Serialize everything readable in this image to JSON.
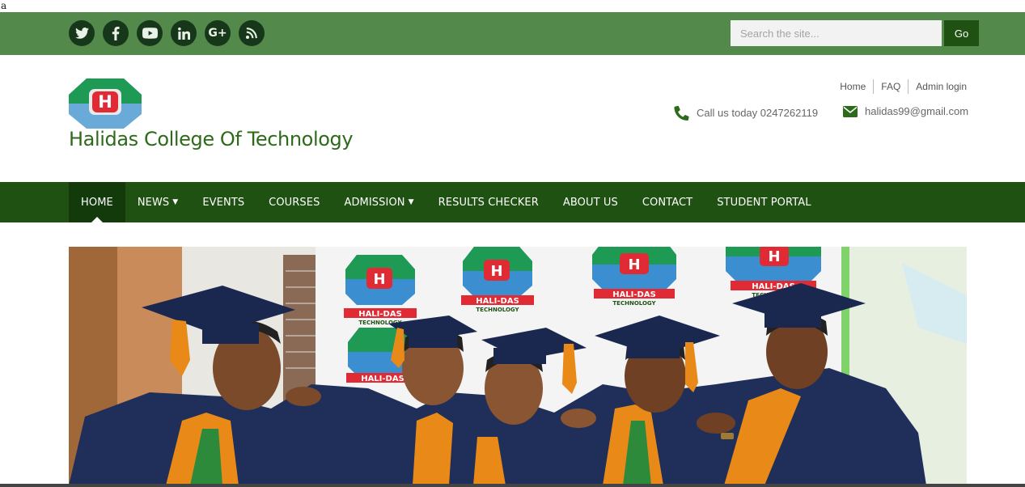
{
  "stray_text": "a",
  "social_icons": [
    "twitter-icon",
    "facebook-icon",
    "youtube-icon",
    "linkedin-icon",
    "google-plus-icon",
    "rss-icon"
  ],
  "search": {
    "placeholder": "Search the site...",
    "button_label": "Go"
  },
  "header": {
    "site_title": "Halidas College Of Technology",
    "top_links": [
      "Home",
      "FAQ",
      "Admin login"
    ],
    "phone_text": "Call us today 0247262119",
    "email_text": "halidas99@gmail.com"
  },
  "nav": {
    "items": [
      {
        "label": "HOME",
        "active": true
      },
      {
        "label": "NEWS",
        "dropdown": true
      },
      {
        "label": "EVENTS"
      },
      {
        "label": "COURSES"
      },
      {
        "label": "ADMISSION",
        "dropdown": true
      },
      {
        "label": "RESULTS CHECKER"
      },
      {
        "label": "ABOUT US"
      },
      {
        "label": "CONTACT"
      },
      {
        "label": "STUDENT PORTAL"
      }
    ]
  },
  "hero": {
    "banner_text": "HALI-DAS",
    "banner_subtext": "TECHNOLOGY",
    "logo_letter": "H"
  },
  "colors": {
    "topbar": "#53894a",
    "nav": "#1f5212",
    "nav_active": "#123a0b",
    "title_green": "#2d6a1a",
    "gown": "#1f2f5a",
    "kente": "#e98a18"
  }
}
